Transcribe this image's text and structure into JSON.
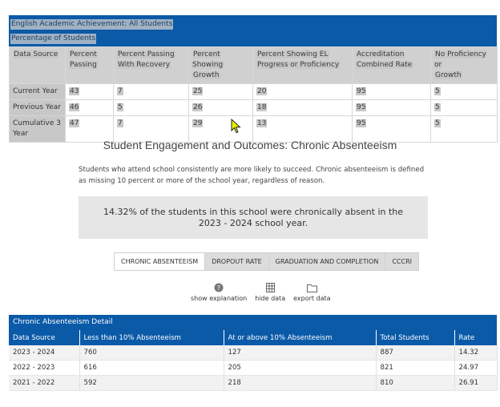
{
  "top_table": {
    "title": "English Academic Achievement: All Students",
    "subtitle": "Percentage of Students",
    "headers": [
      [
        "Data Source",
        ""
      ],
      [
        "Percent",
        "Passing"
      ],
      [
        "Percent Passing",
        "With Recovery"
      ],
      [
        "Percent Showing",
        "Growth"
      ],
      [
        "Percent Showing EL",
        "Progress or Proficiency"
      ],
      [
        "Accreditation",
        "Combined Rate"
      ],
      [
        "No Proficiency or",
        "Growth"
      ]
    ],
    "rows": [
      [
        "Current Year",
        "43",
        "7",
        "25",
        "20",
        "95",
        "5"
      ],
      [
        "Previous Year",
        "46",
        "5",
        "26",
        "18",
        "95",
        "5"
      ],
      [
        "Cumulative 3",
        "47",
        "7",
        "29",
        "13",
        "95",
        "5"
      ]
    ],
    "row3_extra": "Year"
  },
  "section": {
    "title": "Student Engagement and Outcomes: Chronic Absenteeism",
    "description": "Students who attend school consistently are more likely to succeed. Chronic absenteeism is defined as missing 10 percent or more of the school year, regardless of reason.",
    "callout": "14.32% of the students in this school were chronically absent in the 2023 - 2024 school year."
  },
  "tabs": [
    "CHRONIC ABSENTEEISM",
    "DROPOUT RATE",
    "GRADUATION AND COMPLETION",
    "CCCRI"
  ],
  "actions": [
    {
      "label": "show explanation",
      "icon": "question-circle-icon"
    },
    {
      "label": "hide data",
      "icon": "table-grid-icon"
    },
    {
      "label": "export data",
      "icon": "folder-icon"
    }
  ],
  "detail": {
    "title": "Chronic Absenteeism Detail",
    "headers": [
      "Data Source",
      "Less than 10% Absenteeism",
      "At or above 10% Absenteeism",
      "Total Students",
      "Rate"
    ],
    "rows": [
      [
        "2023 - 2024",
        "760",
        "127",
        "887",
        "14.32"
      ],
      [
        "2022 - 2023",
        "616",
        "205",
        "821",
        "24.97"
      ],
      [
        "2021 - 2022",
        "592",
        "218",
        "810",
        "26.91"
      ]
    ]
  },
  "colors": {
    "header_blue": "#0a5aa8",
    "selection_gray": "#c8c8c8"
  }
}
